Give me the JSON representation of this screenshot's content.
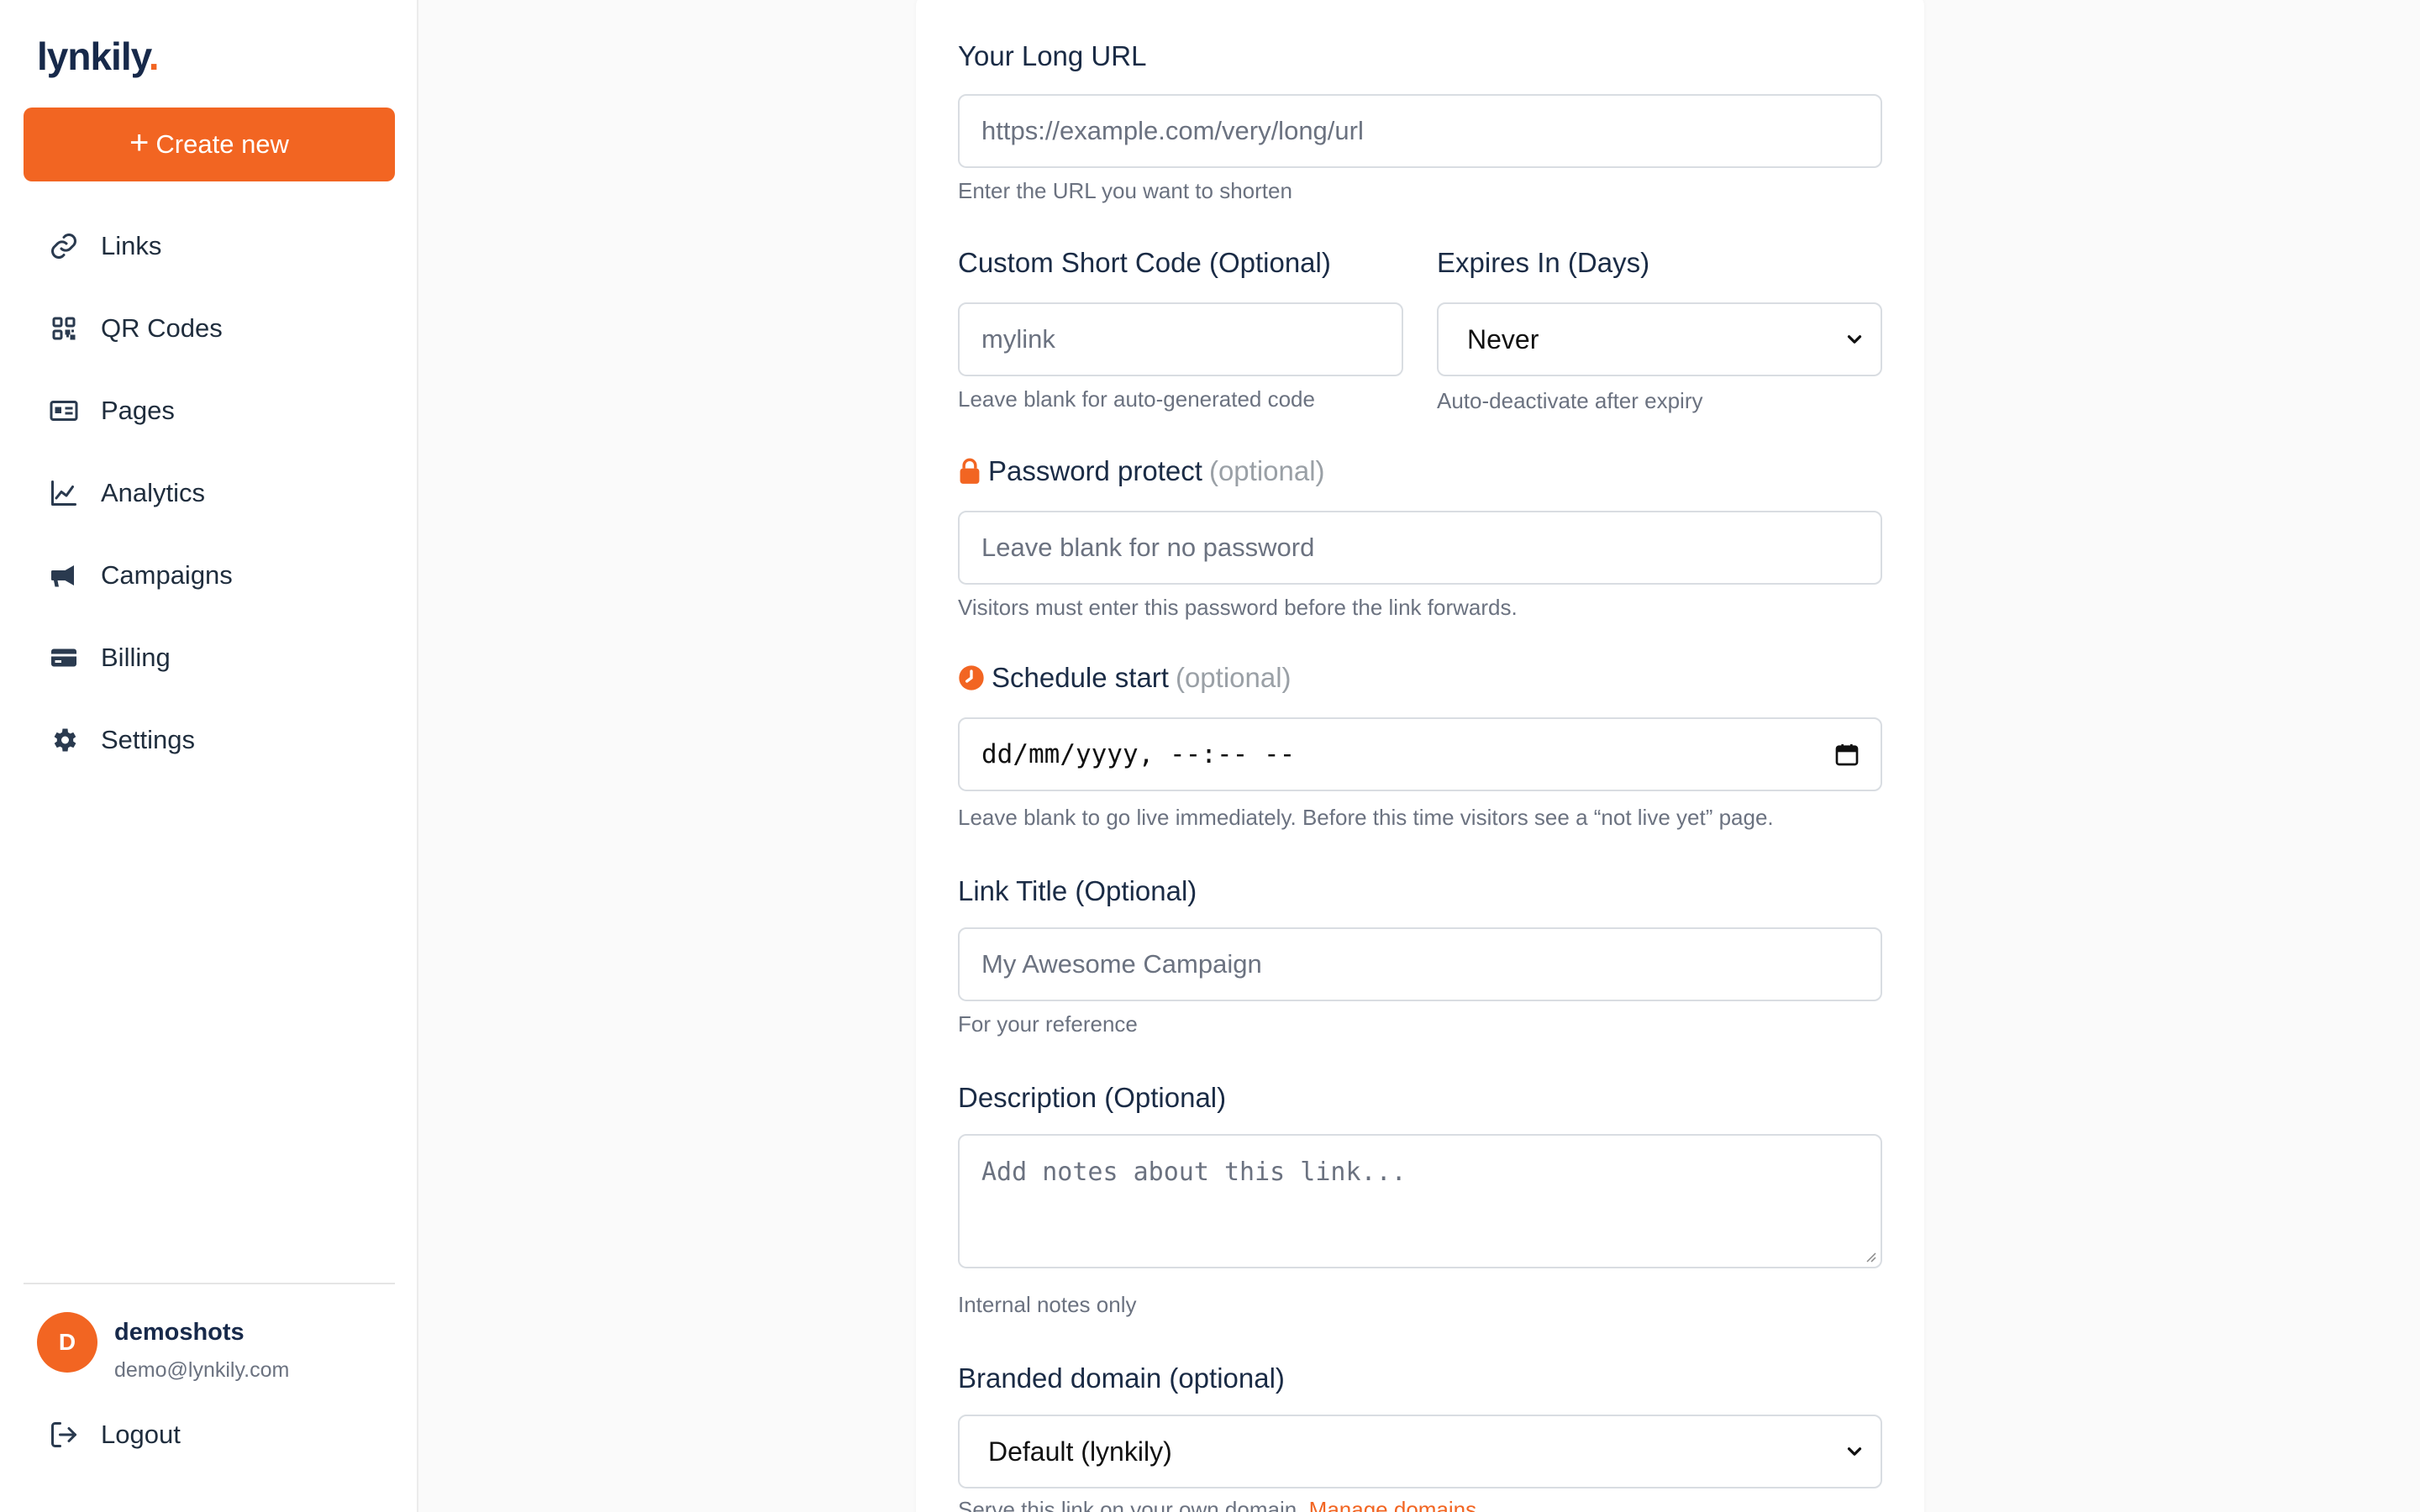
{
  "brand": {
    "name": "lynkily",
    "dot": ".",
    "accent": "#f26522"
  },
  "sidebar": {
    "create_label": "Create new",
    "items": [
      {
        "label": "Links",
        "icon": "link-icon"
      },
      {
        "label": "QR Codes",
        "icon": "qr-code-icon"
      },
      {
        "label": "Pages",
        "icon": "id-card-icon"
      },
      {
        "label": "Analytics",
        "icon": "chart-line-icon"
      },
      {
        "label": "Campaigns",
        "icon": "megaphone-icon"
      },
      {
        "label": "Billing",
        "icon": "credit-card-icon"
      },
      {
        "label": "Settings",
        "icon": "gear-icon"
      }
    ],
    "user": {
      "initial": "D",
      "name": "demoshots",
      "email": "demo@lynkily.com"
    },
    "logout_label": "Logout"
  },
  "form": {
    "long_url": {
      "label": "Your Long URL",
      "placeholder": "https://example.com/very/long/url",
      "help": "Enter the URL you want to shorten"
    },
    "short_code": {
      "label": "Custom Short Code (Optional)",
      "placeholder": "mylink",
      "help": "Leave blank for auto-generated code"
    },
    "expires": {
      "label": "Expires In (Days)",
      "value": "Never",
      "help": "Auto-deactivate after expiry"
    },
    "password": {
      "label": "Password protect",
      "optional": "(optional)",
      "placeholder": "Leave blank for no password",
      "help": "Visitors must enter this password before the link forwards."
    },
    "schedule": {
      "label": "Schedule start",
      "optional": "(optional)",
      "placeholder": "dd/mm/yyyy, --:-- --",
      "help": "Leave blank to go live immediately. Before this time visitors see a “not live yet” page."
    },
    "title": {
      "label": "Link Title (Optional)",
      "placeholder": "My Awesome Campaign",
      "help": "For your reference"
    },
    "description": {
      "label": "Description (Optional)",
      "placeholder": "Add notes about this link...",
      "help": "Internal notes only"
    },
    "domain": {
      "label": "Branded domain (optional)",
      "value": "Default (lynkily)",
      "help": "Serve this link on your own domain.",
      "help_link": "Manage domains"
    }
  }
}
